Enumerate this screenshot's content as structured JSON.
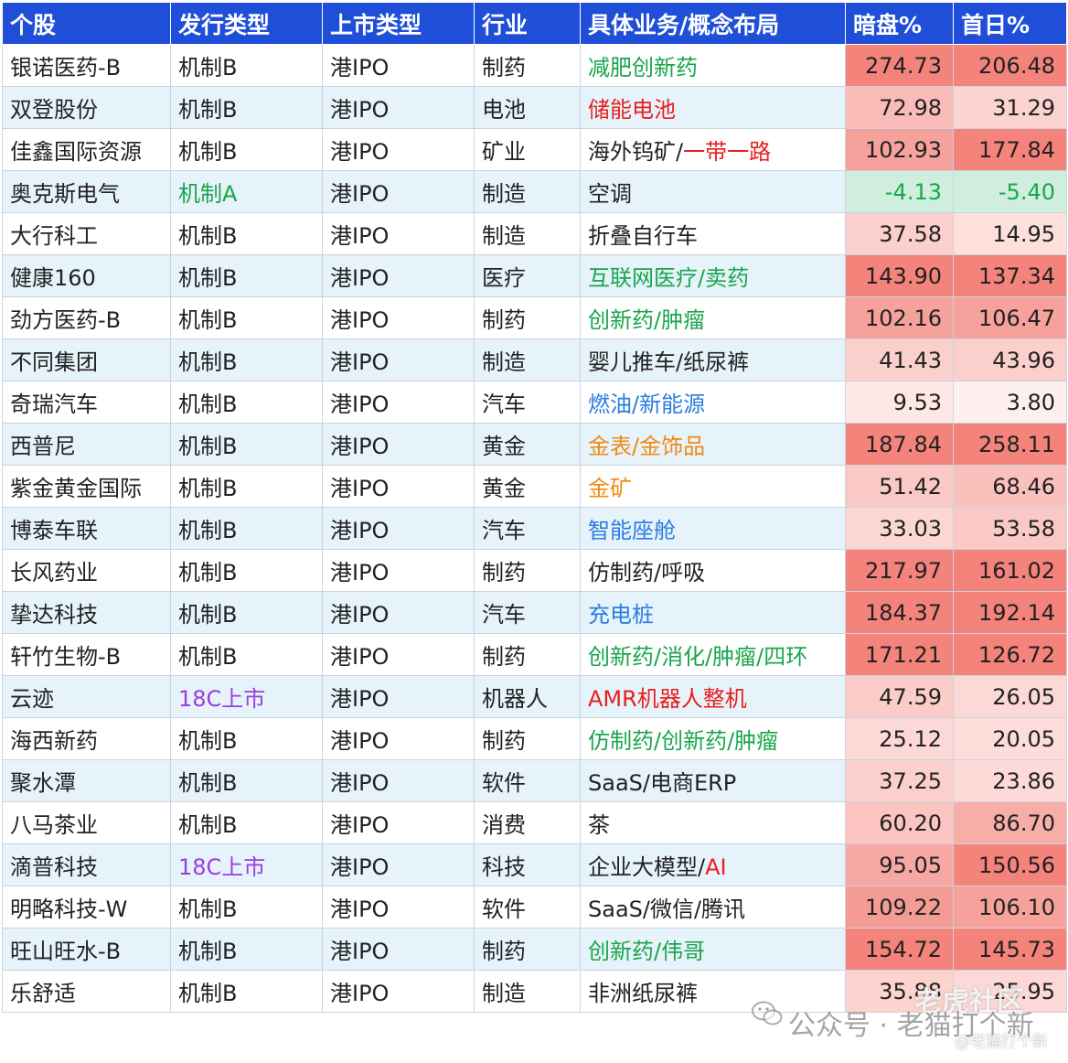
{
  "headers": [
    "个股",
    "发行类型",
    "上市类型",
    "行业",
    "具体业务/概念布局",
    "暗盘%",
    "首日%"
  ],
  "rows": [
    {
      "stock": "银诺医药-B",
      "issue": "机制B",
      "listing": "港IPO",
      "industry": "制药",
      "concept": [
        {
          "t": "减肥创新药",
          "c": "green"
        }
      ],
      "dark": "274.73",
      "first": "206.48",
      "dark_bg": "#f4837c",
      "first_bg": "#f4837c"
    },
    {
      "stock": "双登股份",
      "issue": "机制B",
      "listing": "港IPO",
      "industry": "电池",
      "concept": [
        {
          "t": "储能电池",
          "c": "red"
        }
      ],
      "dark": "72.98",
      "first": "31.29",
      "dark_bg": "#f9bcb8",
      "first_bg": "#fbd3d0"
    },
    {
      "stock": "佳鑫国际资源",
      "issue": "机制B",
      "listing": "港IPO",
      "industry": "矿业",
      "concept": [
        {
          "t": "海外钨矿/",
          "c": ""
        },
        {
          "t": "一带一路",
          "c": "red"
        }
      ],
      "dark": "102.93",
      "first": "177.84",
      "dark_bg": "#f6a19b",
      "first_bg": "#f4837c"
    },
    {
      "stock": "奥克斯电气",
      "issue": "机制A",
      "issue_color": "green",
      "listing": "港IPO",
      "industry": "制造",
      "concept": [
        {
          "t": "空调",
          "c": ""
        }
      ],
      "dark": "-4.13",
      "first": "-5.40",
      "dark_bg": "#cfeedd",
      "first_bg": "#cfeedd",
      "negative": true
    },
    {
      "stock": "大行科工",
      "issue": "机制B",
      "listing": "港IPO",
      "industry": "制造",
      "concept": [
        {
          "t": "折叠自行车",
          "c": ""
        }
      ],
      "dark": "37.58",
      "first": "14.95",
      "dark_bg": "#fbd0cc",
      "first_bg": "#fddfdc"
    },
    {
      "stock": "健康160",
      "issue": "机制B",
      "listing": "港IPO",
      "industry": "医疗",
      "concept": [
        {
          "t": "互联网医疗/卖药",
          "c": "green"
        }
      ],
      "dark": "143.90",
      "first": "137.34",
      "dark_bg": "#f4837c",
      "first_bg": "#f4837c"
    },
    {
      "stock": "劲方医药-B",
      "issue": "机制B",
      "listing": "港IPO",
      "industry": "制药",
      "concept": [
        {
          "t": "创新药/肿瘤",
          "c": "green"
        }
      ],
      "dark": "102.16",
      "first": "106.47",
      "dark_bg": "#f6a19b",
      "first_bg": "#f6a19b"
    },
    {
      "stock": "不同集团",
      "issue": "机制B",
      "listing": "港IPO",
      "industry": "制造",
      "concept": [
        {
          "t": "婴儿推车/纸尿裤",
          "c": ""
        }
      ],
      "dark": "41.43",
      "first": "43.96",
      "dark_bg": "#fbd0cc",
      "first_bg": "#fbd0cc"
    },
    {
      "stock": "奇瑞汽车",
      "issue": "机制B",
      "listing": "港IPO",
      "industry": "汽车",
      "concept": [
        {
          "t": "燃油/新能源",
          "c": "blue"
        }
      ],
      "dark": "9.53",
      "first": "3.80",
      "dark_bg": "#fde8e6",
      "first_bg": "#fdf0ef"
    },
    {
      "stock": "西普尼",
      "issue": "机制B",
      "listing": "港IPO",
      "industry": "黄金",
      "concept": [
        {
          "t": "金表/金饰品",
          "c": "orange"
        }
      ],
      "dark": "187.84",
      "first": "258.11",
      "dark_bg": "#f4837c",
      "first_bg": "#f4837c"
    },
    {
      "stock": "紫金黄金国际",
      "issue": "机制B",
      "listing": "港IPO",
      "industry": "黄金",
      "concept": [
        {
          "t": "金矿",
          "c": "orange"
        }
      ],
      "dark": "51.42",
      "first": "68.46",
      "dark_bg": "#fbc9c5",
      "first_bg": "#fac0bc"
    },
    {
      "stock": "博泰车联",
      "issue": "机制B",
      "listing": "港IPO",
      "industry": "汽车",
      "concept": [
        {
          "t": "智能座舱",
          "c": "blue"
        }
      ],
      "dark": "33.03",
      "first": "53.58",
      "dark_bg": "#fcd6d2",
      "first_bg": "#fbc9c5"
    },
    {
      "stock": "长风药业",
      "issue": "机制B",
      "listing": "港IPO",
      "industry": "制药",
      "concept": [
        {
          "t": "仿制药/呼吸",
          "c": ""
        }
      ],
      "dark": "217.97",
      "first": "161.02",
      "dark_bg": "#f4837c",
      "first_bg": "#f4837c"
    },
    {
      "stock": "挚达科技",
      "issue": "机制B",
      "listing": "港IPO",
      "industry": "汽车",
      "concept": [
        {
          "t": "充电桩",
          "c": "blue"
        }
      ],
      "dark": "184.37",
      "first": "192.14",
      "dark_bg": "#f4837c",
      "first_bg": "#f4837c"
    },
    {
      "stock": "轩竹生物-B",
      "issue": "机制B",
      "listing": "港IPO",
      "industry": "制药",
      "concept": [
        {
          "t": "创新药/消化/肿瘤/四环",
          "c": "green"
        }
      ],
      "dark": "171.21",
      "first": "126.72",
      "dark_bg": "#f4837c",
      "first_bg": "#f4837c"
    },
    {
      "stock": "云迹",
      "issue": "18C上市",
      "issue_color": "purple",
      "listing": "港IPO",
      "industry": "机器人",
      "concept": [
        {
          "t": "AMR机器人整机",
          "c": "red"
        }
      ],
      "dark": "47.59",
      "first": "26.05",
      "dark_bg": "#fbcdc9",
      "first_bg": "#fcd9d6"
    },
    {
      "stock": "海西新药",
      "issue": "机制B",
      "listing": "港IPO",
      "industry": "制药",
      "concept": [
        {
          "t": "仿制药/创新药/肿瘤",
          "c": "green"
        }
      ],
      "dark": "25.12",
      "first": "20.05",
      "dark_bg": "#fcd9d6",
      "first_bg": "#fddcd9"
    },
    {
      "stock": "聚水潭",
      "issue": "机制B",
      "listing": "港IPO",
      "industry": "软件",
      "concept": [
        {
          "t": "SaaS/电商ERP",
          "c": ""
        }
      ],
      "dark": "37.25",
      "first": "23.86",
      "dark_bg": "#fbd0cc",
      "first_bg": "#fddad7"
    },
    {
      "stock": "八马茶业",
      "issue": "机制B",
      "listing": "港IPO",
      "industry": "消费",
      "concept": [
        {
          "t": "茶",
          "c": ""
        }
      ],
      "dark": "60.20",
      "first": "86.70",
      "dark_bg": "#fbc4c0",
      "first_bg": "#f8aea8"
    },
    {
      "stock": "滴普科技",
      "issue": "18C上市",
      "issue_color": "purple",
      "listing": "港IPO",
      "industry": "科技",
      "concept": [
        {
          "t": "企业大模型/",
          "c": ""
        },
        {
          "t": "AI",
          "c": "red"
        }
      ],
      "dark": "95.05",
      "first": "150.56",
      "dark_bg": "#f7a8a2",
      "first_bg": "#f4837c"
    },
    {
      "stock": "明略科技-W",
      "issue": "机制B",
      "listing": "港IPO",
      "industry": "软件",
      "concept": [
        {
          "t": "SaaS/微信/腾讯",
          "c": ""
        }
      ],
      "dark": "109.22",
      "first": "106.10",
      "dark_bg": "#f59b95",
      "first_bg": "#f6a19b"
    },
    {
      "stock": "旺山旺水-B",
      "issue": "机制B",
      "listing": "港IPO",
      "industry": "制药",
      "concept": [
        {
          "t": "创新药/伟哥",
          "c": "green"
        }
      ],
      "dark": "154.72",
      "first": "145.73",
      "dark_bg": "#f4837c",
      "first_bg": "#f4837c"
    },
    {
      "stock": "乐舒适",
      "issue": "机制B",
      "listing": "港IPO",
      "industry": "制造",
      "concept": [
        {
          "t": "非洲纸尿裤",
          "c": ""
        }
      ],
      "dark": "35.88",
      "first": "25.95",
      "dark_bg": "#fcd3cf",
      "first_bg": "#fcd9d6"
    }
  ],
  "watermark": {
    "line1": "老虎社区",
    "line2": "公众号 · 老猫打个新",
    "line3": "@老猫打个新",
    "icon": "wechat-icon"
  }
}
